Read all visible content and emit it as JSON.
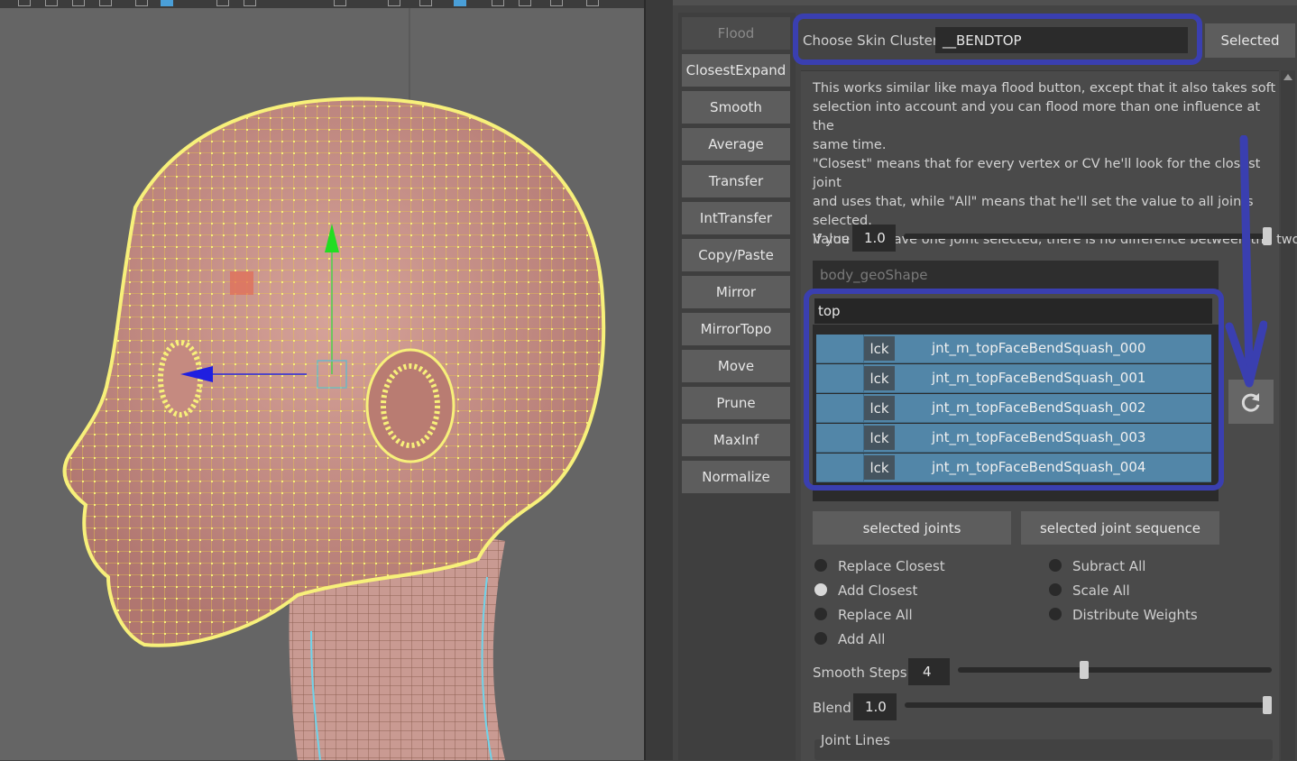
{
  "side_buttons": [
    "Flood",
    "ClosestExpand",
    "Smooth",
    "Average",
    "Transfer",
    "IntTransfer",
    "Copy/Paste",
    "Mirror",
    "MirrorTopo",
    "Move",
    "Prune",
    "MaxInf",
    "Normalize"
  ],
  "skin_cluster": {
    "label": "Choose Skin Cluster",
    "value": "__BENDTOP",
    "selected_button": "Selected"
  },
  "description": {
    "line1": "This works similar like maya flood button, except that it also takes soft",
    "line2": "selection into account and you can flood more than one influence at the",
    "line3": "same time.",
    "line4": "\"Closest\" means that for every vertex or CV he'll look for the closest joint",
    "line5": "and uses that, while \"All\" means that he'll set the value to all joints",
    "line6": "selected.",
    "line7": "If you only have one joint selected, there is no difference between the two"
  },
  "value": {
    "label": "Value",
    "value": "1.0",
    "level": 1.0
  },
  "mesh_field": "body_geoShape",
  "filter": "top",
  "joints": [
    {
      "lock": "lck",
      "name": "jnt_m_topFaceBendSquash_000"
    },
    {
      "lock": "lck",
      "name": "jnt_m_topFaceBendSquash_001"
    },
    {
      "lock": "lck",
      "name": "jnt_m_topFaceBendSquash_002"
    },
    {
      "lock": "lck",
      "name": "jnt_m_topFaceBendSquash_003"
    },
    {
      "lock": "lck",
      "name": "jnt_m_topFaceBendSquash_004"
    }
  ],
  "buttons": {
    "selected_joints": "selected joints",
    "selected_joint_sequence": "selected joint sequence"
  },
  "modes_left": [
    "Replace Closest",
    "Add Closest",
    "Replace All",
    "Add All"
  ],
  "modes_right": [
    "Subract All",
    "Scale All",
    "Distribute Weights"
  ],
  "selected_mode": "Add Closest",
  "smooth_steps": {
    "label": "Smooth Steps",
    "value": "4",
    "level": 0.28
  },
  "blend": {
    "label": "Blend",
    "value": "1.0",
    "level": 1.0
  },
  "joint_lines": "Joint Lines",
  "icons": {
    "refresh": "refresh-icon",
    "annotation_arrow": "arrow-down-icon"
  },
  "colors": {
    "highlight": "#3a3fb0",
    "row": "#5286a8",
    "wire": "#f5f06a",
    "skin": "#c9948a"
  }
}
